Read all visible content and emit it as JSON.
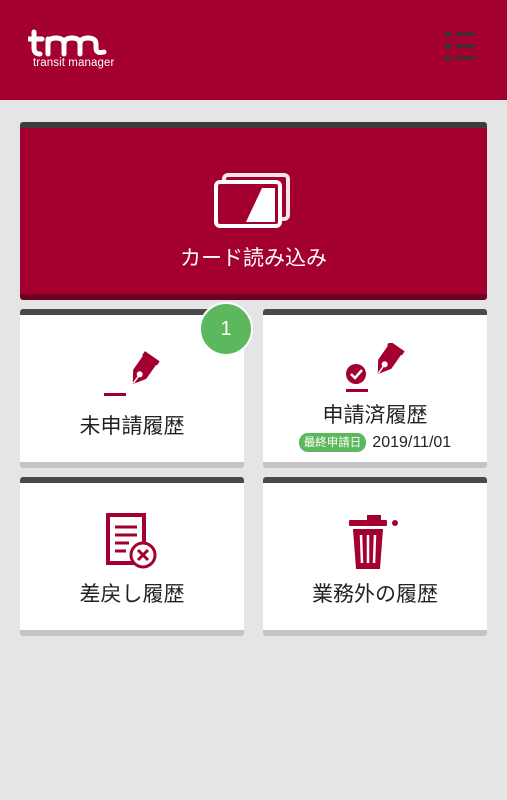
{
  "header": {
    "logo_text": "tm",
    "logo_subtitle": "transit manager",
    "menu_icon": "list-menu-icon",
    "background": "#a3002f"
  },
  "cards": {
    "read_card": {
      "label": "カード読み込み",
      "icon": "card-icon"
    },
    "unfiled": {
      "label": "未申請履歴",
      "icon": "pen-icon",
      "badge": "1"
    },
    "filed": {
      "label": "申請済履歴",
      "icon": "pen-check-icon",
      "date_label": "最終申請日",
      "date_value": "2019/11/01"
    },
    "returned": {
      "label": "差戻し履歴",
      "icon": "document-reject-icon"
    },
    "non_business": {
      "label": "業務外の履歴",
      "icon": "trash-icon"
    }
  },
  "colors": {
    "accent": "#a3002f",
    "badge": "#5cb85c"
  }
}
